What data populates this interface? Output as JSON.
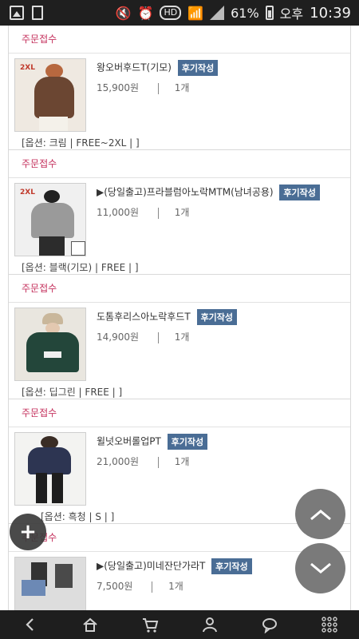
{
  "status_bar": {
    "battery_percent": "61%",
    "ampm": "오후",
    "time": "10:39",
    "hd_label": "HD",
    "icons": [
      "gallery-icon",
      "trash-icon",
      "mute-icon",
      "alarm-icon",
      "hd-icon",
      "wifi-icon",
      "signal-icon",
      "battery-icon"
    ]
  },
  "orders": [
    {
      "status": "주문접수",
      "name": "왕오버후드T(기모)",
      "review_label": "후기작성",
      "price": "15,900원",
      "qty": "1개",
      "option": "[옵션: 크림 | FREE~2XL | ]"
    },
    {
      "status": "주문접수",
      "name": "▶(당일출고)프라블럼아노락MTM(남녀공용)",
      "review_label": "후기작성",
      "price": "11,000원",
      "qty": "1개",
      "option": "[옵션: 블랙(기모) | FREE | ]"
    },
    {
      "status": "주문접수",
      "name": "도톰후리스아노락후드T",
      "review_label": "후기작성",
      "price": "14,900원",
      "qty": "1개",
      "option": "[옵션: 딥그린 | FREE | ]"
    },
    {
      "status": "주문접수",
      "name": "윌넛오버롤업PT",
      "review_label": "후기작성",
      "price": "21,000원",
      "qty": "1개",
      "option": "[옵션: 흑청 | S | ]"
    },
    {
      "status": "주문접수",
      "name": "▶(당일출고)미네잔단가라T",
      "review_label": "후기작성",
      "price": "7,500원",
      "qty": "1개"
    }
  ],
  "thumb_badges": {
    "first": "2XL",
    "second": "2XL"
  },
  "floating": {
    "plus": "+",
    "up_icon": "chevron-up-icon",
    "down_icon": "chevron-down-icon"
  },
  "bottom_nav": [
    "back-icon",
    "home-icon",
    "cart-icon",
    "user-icon",
    "chat-icon",
    "menu-grid-icon"
  ]
}
